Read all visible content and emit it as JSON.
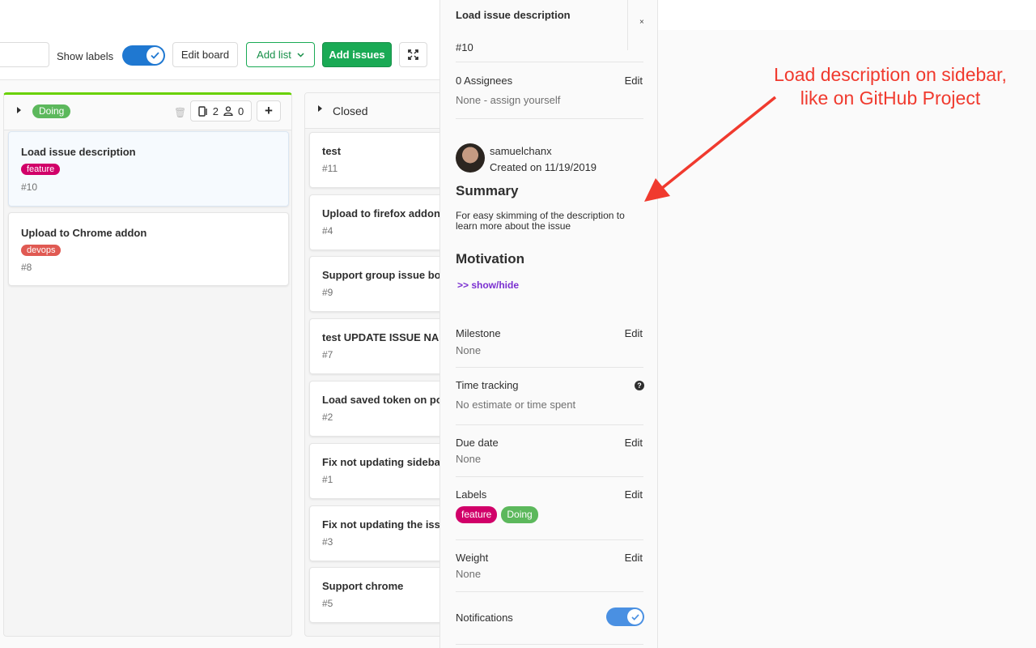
{
  "toolbar": {
    "show_labels": "Show labels",
    "edit_board": "Edit board",
    "add_list": "Add list",
    "add_issues": "Add issues"
  },
  "boards": {
    "doing": {
      "label": "Doing",
      "label_color": "#5cb85c",
      "issue_count": "2",
      "assignee_count": "0",
      "cards": [
        {
          "title": "Load issue description",
          "label": "feature",
          "label_color": "#d10069",
          "number": "#10"
        },
        {
          "title": "Upload to Chrome addon",
          "label": "devops",
          "label_color": "#e05a53",
          "number": "#8"
        }
      ]
    },
    "closed": {
      "title": "Closed",
      "cards": [
        {
          "title": "test",
          "number": "#11"
        },
        {
          "title": "Upload to firefox addon",
          "number": "#4"
        },
        {
          "title": "Support group issue bo",
          "number": "#9"
        },
        {
          "title": "test UPDATE ISSUE NAI",
          "number": "#7"
        },
        {
          "title": "Load saved token on po",
          "number": "#2"
        },
        {
          "title": "Fix not updating sideba",
          "number": "#1"
        },
        {
          "title": "Fix not updating the iss",
          "number": "#3"
        },
        {
          "title": "Support chrome",
          "number": "#5"
        }
      ]
    }
  },
  "sidebar": {
    "title": "Load issue description",
    "close": "×",
    "reference": "#10",
    "assignees_label": "0 Assignees",
    "assignees_edit": "Edit",
    "assignees_none": "None -",
    "assign_yourself": "assign yourself",
    "author": "samuelchanx",
    "created": "Created on 11/19/2019",
    "summary_heading": "Summary",
    "summary_text": "For easy skimming of the description to learn more about the issue",
    "motivation_heading": "Motivation",
    "show_hide": ">> show/hide",
    "milestone_label": "Milestone",
    "milestone_edit": "Edit",
    "milestone_value": "None",
    "time_tracking_label": "Time tracking",
    "time_tracking_value": "No estimate or time spent",
    "due_date_label": "Due date",
    "due_date_edit": "Edit",
    "due_date_value": "None",
    "labels_label": "Labels",
    "labels_edit": "Edit",
    "labels": [
      {
        "name": "feature",
        "color": "#d10069"
      },
      {
        "name": "Doing",
        "color": "#5cb85c"
      }
    ],
    "weight_label": "Weight",
    "weight_edit": "Edit",
    "weight_value": "None",
    "notifications_label": "Notifications",
    "notifications_on": true
  },
  "annotation": {
    "line1": "Load description on sidebar,",
    "line2": "like on GitHub Project",
    "color": "#f03a2e"
  }
}
